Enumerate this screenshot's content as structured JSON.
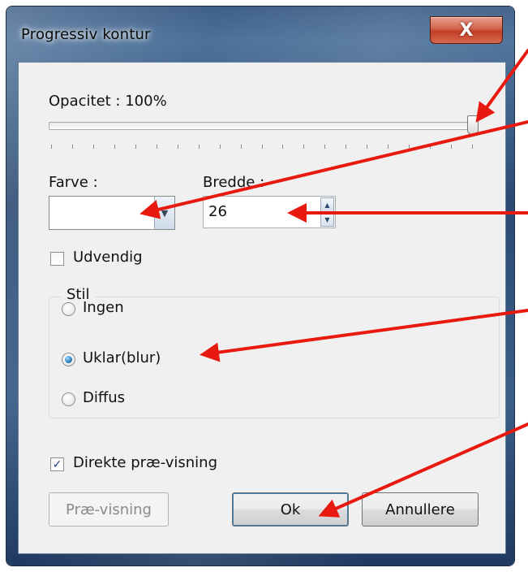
{
  "window": {
    "title": "Progressiv kontur",
    "close_glyph": "X"
  },
  "opacity": {
    "label": "Opacitet : 100%",
    "value_percent": 100
  },
  "color": {
    "label": "Farve :",
    "swatch": "#ffffff",
    "dropdown_glyph": "▼"
  },
  "width": {
    "label": "Bredde :",
    "value": "26",
    "up_glyph": "▲",
    "down_glyph": "▼"
  },
  "outside": {
    "label": "Udvendig",
    "checked": false
  },
  "style_group": {
    "title": "Stil",
    "options": [
      {
        "label": "Ingen",
        "selected": false
      },
      {
        "label": "Uklar(blur)",
        "selected": true
      },
      {
        "label": "Diffus",
        "selected": false
      }
    ]
  },
  "preview_checkbox": {
    "label": "Direkte præ-visning",
    "checked": true,
    "check_glyph": "✓"
  },
  "buttons": {
    "preview": "Præ-visning",
    "ok": "Ok",
    "cancel": "Annullere"
  },
  "annotation": {
    "arrow_color": "#e8190f"
  }
}
